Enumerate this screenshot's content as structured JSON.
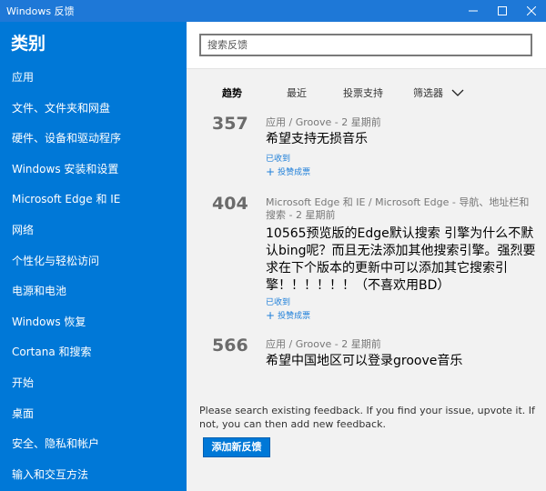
{
  "window": {
    "title": "Windows 反馈",
    "bg_color": "#1e78d7"
  },
  "sidebar": {
    "title": "类别",
    "bg_color": "#0078d7",
    "items": [
      {
        "label": "应用"
      },
      {
        "label": "文件、文件夹和网盘"
      },
      {
        "label": "硬件、设备和驱动程序"
      },
      {
        "label": "Windows 安装和设置"
      },
      {
        "label": "Microsoft Edge 和 IE"
      },
      {
        "label": "网络"
      },
      {
        "label": "个性化与轻松访问"
      },
      {
        "label": "电源和电池"
      },
      {
        "label": "Windows 恢复"
      },
      {
        "label": "Cortana 和搜索"
      },
      {
        "label": "开始"
      },
      {
        "label": "桌面"
      },
      {
        "label": "安全、隐私和帐户"
      },
      {
        "label": "输入和交互方法"
      }
    ]
  },
  "search": {
    "placeholder": "搜索反馈"
  },
  "tabs": {
    "trend": "趋势",
    "recent": "最近",
    "votes": "投票支持",
    "filter": "筛选器"
  },
  "feedback": [
    {
      "votes": "357",
      "meta": "应用 / Groove - 2 星期前",
      "title": "希望支持无损音乐",
      "status": "已收到",
      "upvote": "投赞成票"
    },
    {
      "votes": "404",
      "meta": "Microsoft Edge 和 IE / Microsoft Edge - 导航、地址栏和搜索 - 2 星期前",
      "title": "10565预览版的Edge默认搜索 引擎为什么不默认bing呢？而且无法添加其他搜索引擎。强烈要求在下个版本的更新中可以添加其它搜索引擎！！！！！！（不喜欢用BD）",
      "status": "已收到",
      "upvote": "投赞成票"
    },
    {
      "votes": "566",
      "meta": "应用 / Groove - 2 星期前",
      "title": "希望中国地区可以登录groove音乐"
    }
  ],
  "bottom": {
    "help_text": "Please search existing feedback. If you find your issue, upvote it. If not, you can then add new feedback.",
    "add_button": "添加新反馈"
  }
}
